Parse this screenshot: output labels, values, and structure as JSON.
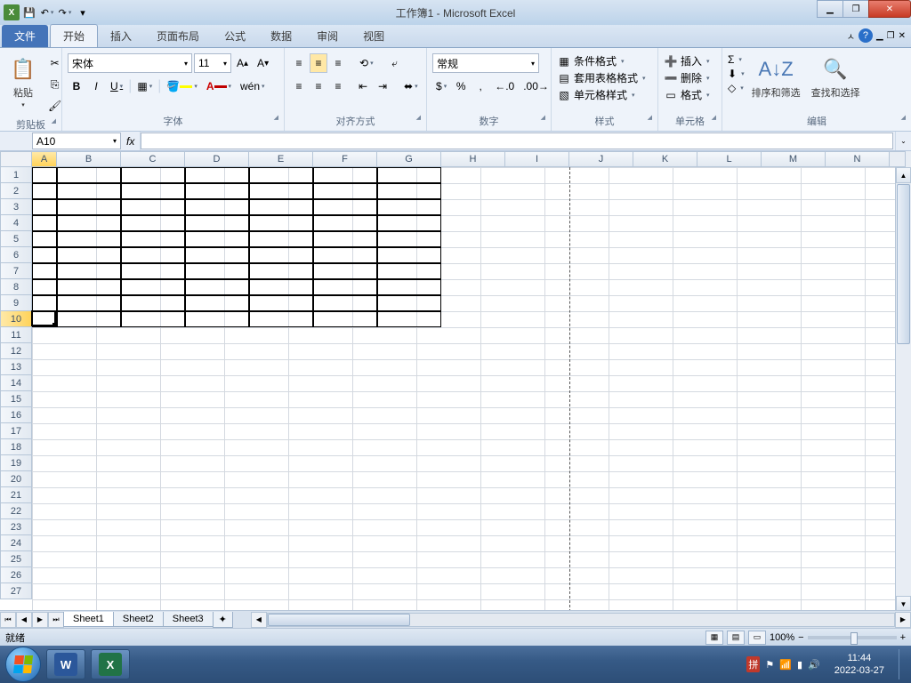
{
  "title": "工作簿1 - Microsoft Excel",
  "qat": {
    "save": "💾",
    "undo": "↶",
    "redo": "↷"
  },
  "tabs": {
    "file": "文件",
    "items": [
      "开始",
      "插入",
      "页面布局",
      "公式",
      "数据",
      "审阅",
      "视图"
    ],
    "active": 0
  },
  "ribbon": {
    "clipboard": {
      "paste": "粘贴",
      "label": "剪贴板",
      "cut": "✂",
      "copy": "⎘",
      "brush": "🖌"
    },
    "font": {
      "name": "宋体",
      "size": "11",
      "label": "字体",
      "bold": "B",
      "italic": "I",
      "underline": "U",
      "grow": "A",
      "shrink": "A",
      "wen": "wén"
    },
    "align": {
      "label": "对齐方式",
      "wrap": "┅",
      "merge": "⬌"
    },
    "number": {
      "format": "常规",
      "label": "数字",
      "currency": "$",
      "percent": "%",
      "comma": ",",
      "dec_inc": ".0",
      "dec_dec": ".00"
    },
    "styles": {
      "label": "样式",
      "cond": "条件格式",
      "table": "套用表格格式",
      "cell": "单元格样式"
    },
    "cells": {
      "label": "单元格",
      "insert": "插入",
      "delete": "删除",
      "format": "格式"
    },
    "editing": {
      "label": "编辑",
      "sum": "Σ",
      "fill": "⬇",
      "clear": "◇",
      "sort": "排序和筛选",
      "find": "查找和选择"
    }
  },
  "namebox": "A10",
  "fx": "fx",
  "columns": [
    "A",
    "B",
    "C",
    "D",
    "E",
    "F",
    "G",
    "H",
    "I",
    "J",
    "K",
    "L",
    "M",
    "N"
  ],
  "rows": 27,
  "active_cell": {
    "row": 10,
    "col": 1
  },
  "selected_col": 1,
  "selected_row": 10,
  "bordered_region": {
    "r1": 1,
    "c1": 1,
    "r2": 10,
    "c2": 7
  },
  "page_break_col": 10,
  "sheets": {
    "items": [
      "Sheet1",
      "Sheet2",
      "Sheet3"
    ],
    "active": 0
  },
  "status": {
    "ready": "就绪",
    "zoom": "100%"
  },
  "taskbar": {
    "time": "11:44",
    "date": "2022-03-27"
  }
}
